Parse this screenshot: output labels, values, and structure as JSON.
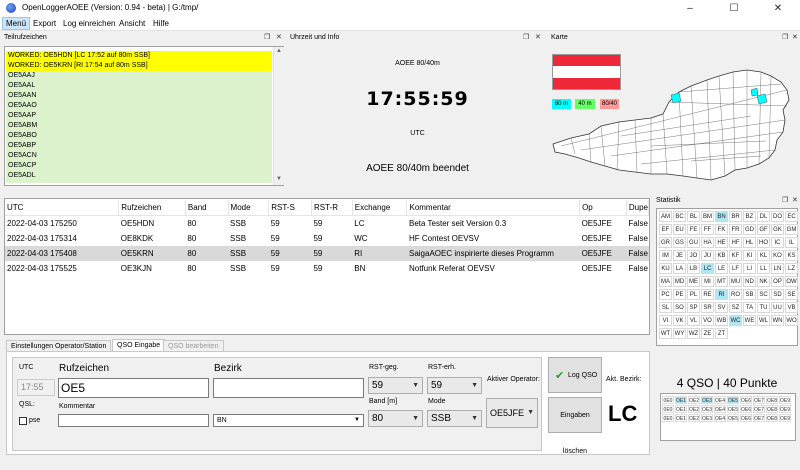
{
  "window": {
    "title": "OpenLoggerAOEE (Version: 0.94 - beta) | G:/tmp/"
  },
  "menu": [
    "Menü",
    "Export",
    "Log einreichen",
    "Ansicht",
    "Hilfe"
  ],
  "callsigns": {
    "title": "Teilrufzeichen",
    "worked": [
      "WORKED: OE5HDN [LC 17:52 auf 80m SSB]",
      "WORKED: OE5KRN [RI 17:54 auf 80m SSB]"
    ],
    "items": [
      "OE5AAJ",
      "OE5AAL",
      "OE5AAN",
      "OE5AAO",
      "OE5AAP",
      "OE5ABM",
      "OE5ABO",
      "OE5ABP",
      "OE5ACN",
      "OE5ACP",
      "OE5ADL"
    ]
  },
  "clock": {
    "title": "Uhrzeit und Info",
    "contest": "AOEE 80/40m",
    "time": "17:55:59",
    "tz": "UTC",
    "status": "AOEE 80/40m beendet"
  },
  "map": {
    "title": "Karte",
    "legend": {
      "b80": "80 m",
      "b40": "40 m",
      "b8040": "80/40"
    },
    "colors": {
      "flag_red": "#ed2939",
      "b80": "#00ffff",
      "b40": "#66ff66",
      "b8040": "#ff9999"
    }
  },
  "log": {
    "headers": [
      "UTC",
      "Rufzeichen",
      "Band",
      "Mode",
      "RST-S",
      "RST-R",
      "Exchange",
      "Kommentar",
      "Op",
      "Dupe"
    ],
    "rows": [
      [
        "2022-04-03 175250",
        "OE5HDN",
        "80",
        "SSB",
        "59",
        "59",
        "LC",
        "Beta Tester seit Version 0.3",
        "OE5JFE",
        "False"
      ],
      [
        "2022-04-03 175314",
        "OE8KDK",
        "80",
        "SSB",
        "59",
        "59",
        "WC",
        "HF Contest OEVSV",
        "OE5JFE",
        "False"
      ],
      [
        "2022-04-03 175408",
        "OE5KRN",
        "80",
        "SSB",
        "59",
        "59",
        "RI",
        "SaigaAOEC inspirierte dieses Programm",
        "OE5JFE",
        "False"
      ],
      [
        "2022-04-03 175525",
        "OE3KJN",
        "80",
        "SSB",
        "59",
        "59",
        "BN",
        "Notfunk Referat OEVSV",
        "OE5JFE",
        "False"
      ]
    ]
  },
  "stats": {
    "title": "Statistik",
    "cells": [
      "AM",
      "BC",
      "BL",
      "BM",
      "BN",
      "BR",
      "BZ",
      "DL",
      "DO",
      "EC",
      "EF",
      "EU",
      "FE",
      "FF",
      "FK",
      "FR",
      "GD",
      "GF",
      "GK",
      "GM",
      "GR",
      "GS",
      "GU",
      "HA",
      "HE",
      "HF",
      "HL",
      "HO",
      "IC",
      "IL",
      "IM",
      "JE",
      "JO",
      "JU",
      "KB",
      "KF",
      "KI",
      "KL",
      "KO",
      "KS",
      "KU",
      "LA",
      "LB",
      "LC",
      "LE",
      "LF",
      "LI",
      "LL",
      "LN",
      "LZ",
      "MA",
      "MD",
      "ME",
      "MI",
      "MT",
      "MU",
      "ND",
      "NK",
      "OP",
      "OW",
      "PC",
      "PE",
      "PL",
      "RE",
      "RI",
      "RO",
      "SB",
      "SC",
      "SD",
      "SE",
      "SL",
      "SO",
      "SP",
      "SR",
      "SV",
      "SZ",
      "TA",
      "TU",
      "UU",
      "VB",
      "VI",
      "VK",
      "VL",
      "VO",
      "WB",
      "WC",
      "WE",
      "WL",
      "WN",
      "WO",
      "WT",
      "WY",
      "WZ",
      "ZE",
      "ZT"
    ],
    "highlighted": [
      "BN",
      "LC",
      "RI",
      "WC"
    ],
    "summary": "4 QSO | 40 Punkte"
  },
  "qso_grid": {
    "cells": [
      "0E0",
      "OE1",
      "OE2",
      "OE3",
      "OE4",
      "OE5",
      "OE6",
      "OE7",
      "OE8",
      "OE9",
      "0E0",
      "OE1",
      "OE2",
      "OE3",
      "OE4",
      "OE5",
      "OE6",
      "OE7",
      "OE8",
      "OE9",
      "0E0",
      "OE1",
      "OE2",
      "OE3",
      "OE4",
      "OE5",
      "OE6",
      "OE7",
      "OE8",
      "OE9"
    ],
    "highlighted_idx": [
      1,
      3,
      5
    ]
  },
  "tabs": [
    "Einstellungen Operator/Station",
    "QSO Eingabe",
    "QSO bearbeiten"
  ],
  "entry": {
    "utc_label": "UTC",
    "utc_value": "17:55",
    "qsl_label": "QSL:",
    "pse_label": "pse",
    "call_label": "Rufzeichen",
    "call_value": "OE5",
    "comment_label": "Kommentar",
    "district_label": "Bezirk",
    "district_value": "BN",
    "rst_s_label": "RST-geg.",
    "rst_s_value": "59",
    "rst_r_label": "RST-erh.",
    "rst_r_value": "59",
    "band_label": "Band [m]",
    "band_value": "80",
    "mode_label": "Mode",
    "mode_value": "SSB",
    "operator_label": "Aktiver Operator:",
    "operator_value": "OE5JFE",
    "log_button": "Log QSO",
    "clear_button": "Eingaben löschen",
    "current_district_label": "Akt. Bezirk:",
    "current_district_value": "LC"
  }
}
